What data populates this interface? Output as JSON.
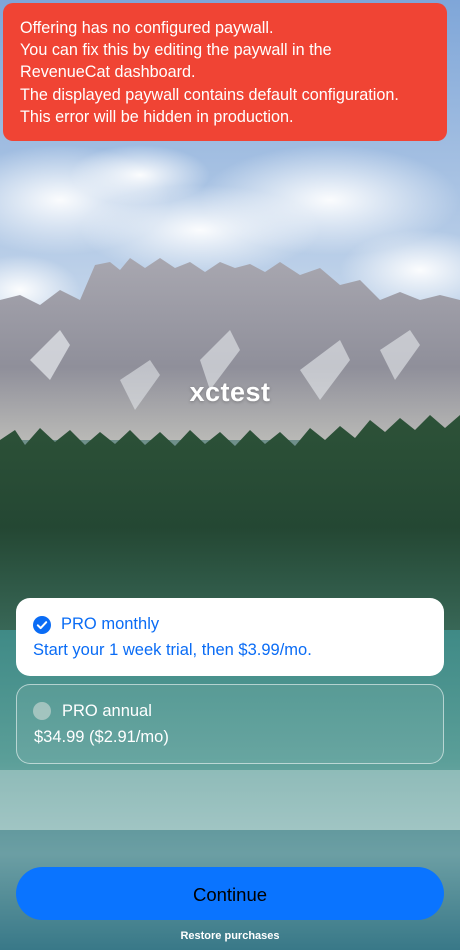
{
  "error_banner": {
    "lines": [
      "Offering has no configured paywall.",
      "You can fix this by editing the paywall in the",
      "RevenueCat dashboard.",
      "The displayed paywall contains default configuration.",
      "This error will be hidden in production."
    ],
    "color": "#f04434"
  },
  "app": {
    "title": "xctest"
  },
  "packages": [
    {
      "title": "PRO monthly",
      "description": "Start your 1 week trial, then $3.99/mo.",
      "selected": true
    },
    {
      "title": "PRO annual",
      "description": "$34.99 ($2.91/mo)",
      "selected": false
    }
  ],
  "actions": {
    "continue_label": "Continue",
    "restore_label": "Restore purchases"
  },
  "colors": {
    "accent": "#0a74ff",
    "selected_text": "#0a6cf5"
  },
  "icons": {
    "selected_indicator": "checkmark-circle-icon",
    "unselected_indicator": "radio-circle-icon"
  }
}
